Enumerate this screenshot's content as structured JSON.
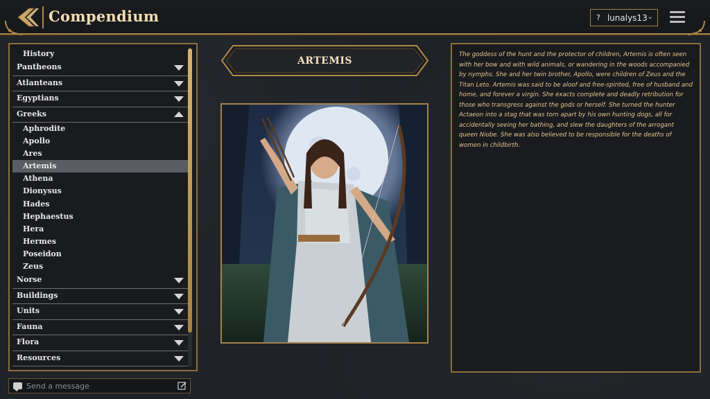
{
  "header": {
    "title": "Compendium",
    "user_prefix": "?",
    "username": "lunalys13"
  },
  "sidebar": {
    "top_item": "History",
    "categories_before": [
      "Pantheons",
      "Atlanteans",
      "Egyptians"
    ],
    "expanded_category": "Greeks",
    "sub_items": [
      "Aphrodite",
      "Apollo",
      "Ares",
      "Artemis",
      "Athena",
      "Dionysus",
      "Hades",
      "Hephaestus",
      "Hera",
      "Hermes",
      "Poseidon",
      "Zeus"
    ],
    "selected_item": "Artemis",
    "categories_after": [
      "Norse",
      "Buildings",
      "Units",
      "Fauna",
      "Flora",
      "Resources"
    ]
  },
  "chat": {
    "placeholder": "Send a message"
  },
  "main": {
    "name": "ARTEMIS",
    "description": "The goddess of the hunt and the protector of children, Artemis is often seen with her bow and with wild animals, or wandering in the woods accompanied by nymphs. She and her twin brother, Apollo, were children of Zeus and the Titan Leto. Artemis was said to be aloof and free-spirited, free of husband and home, and forever a virgin. She exacts complete and deadly retribution for those who transgress against the gods or herself. She turned the hunter Actaeon into a stag that was torn apart by his own hunting dogs, all for accidentally seeing her bathing, and slew the daughters of the arrogant queen Niobe. She was also believed to be responsible for the deaths of women in childbirth."
  },
  "colors": {
    "gold": "#b08a4a",
    "text_gold": "#e6c58f",
    "selected_bg": "#5a5d62"
  }
}
